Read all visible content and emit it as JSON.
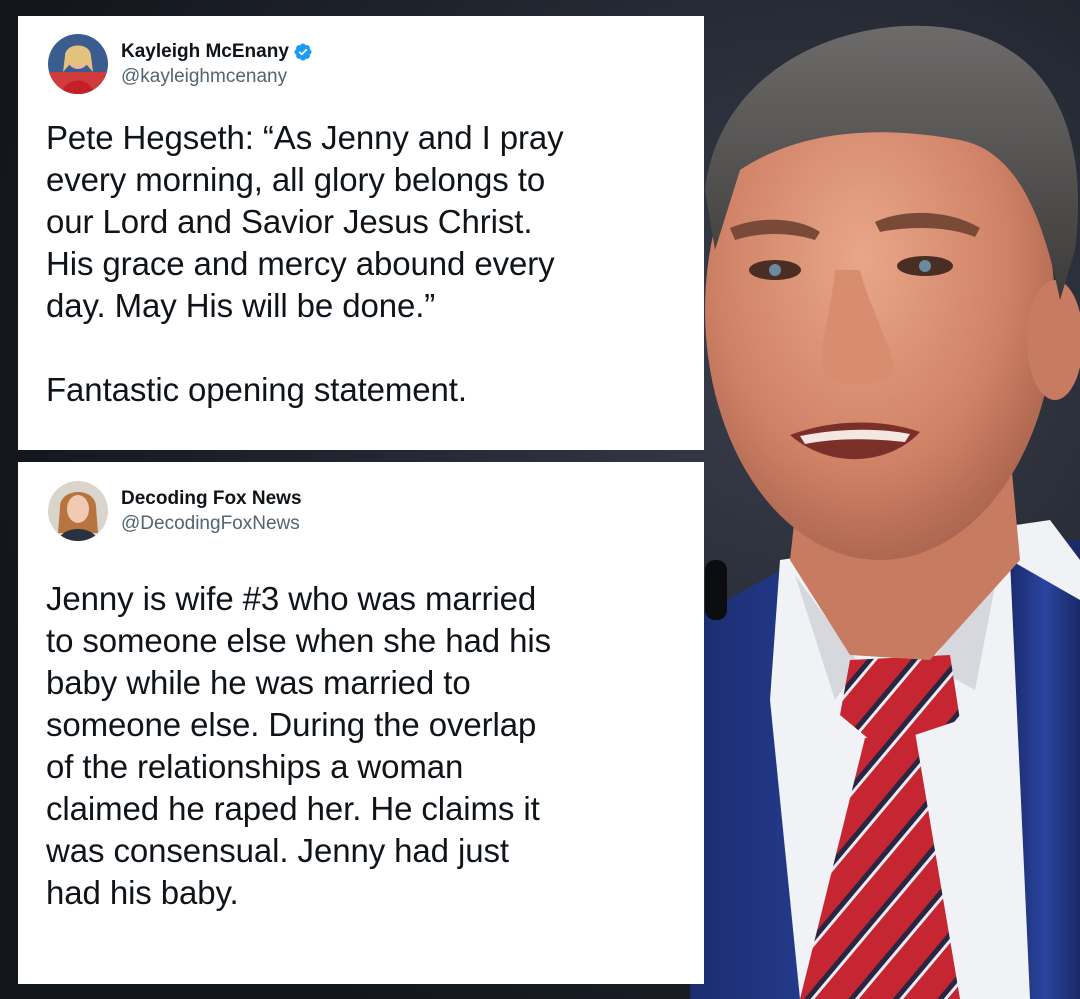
{
  "tweets": [
    {
      "display_name": "Kayleigh McEnany",
      "handle": "@kayleighmcenany",
      "verified": true,
      "avatar_icon": "avatar-photo-icon",
      "text": "Pete Hegseth: “As Jenny and I pray\nevery morning, all glory belongs to\nour Lord and Savior Jesus Christ.\nHis grace and mercy abound every\nday. May His will be done.”\n\nFantastic opening statement."
    },
    {
      "display_name": "Decoding Fox News",
      "handle": "@DecodingFoxNews",
      "verified": false,
      "avatar_icon": "avatar-photo-icon",
      "text": "Jenny is wife #3 who was married\nto someone else when she had his\nbaby while he was married to\nsomeone else. During the overlap\nof the relationships a woman\nclaimed he raped her. He claims it\nwas consensual. Jenny had just\nhad his baby."
    }
  ],
  "colors": {
    "verified_badge": "#1d9bf0",
    "handle": "#536471",
    "text": "#0f1419",
    "tie_red": "#c62632",
    "suit_blue": "#243a8a"
  }
}
